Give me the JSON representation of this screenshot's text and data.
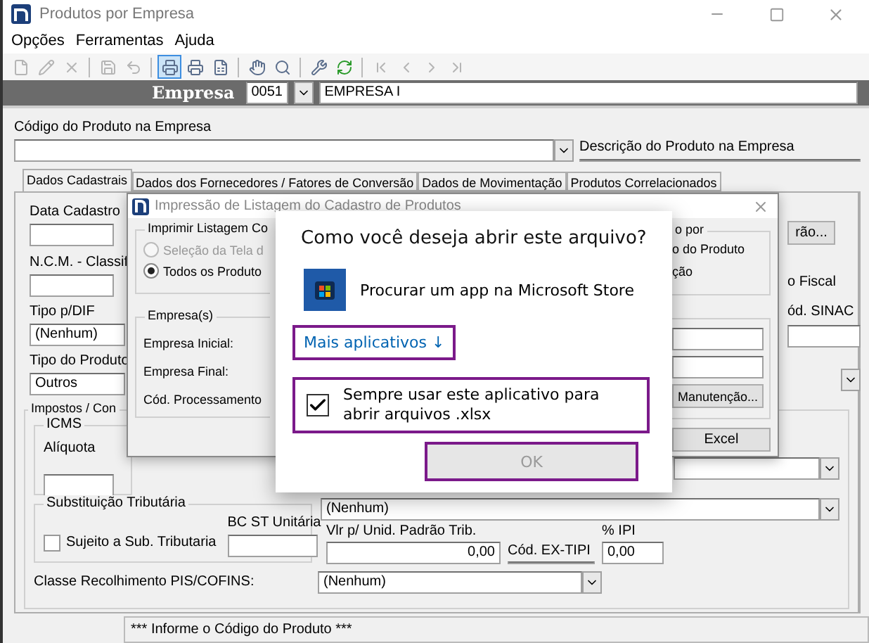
{
  "window": {
    "title": "Produtos por Empresa"
  },
  "menu": [
    "Opções",
    "Ferramentas",
    "Ajuda"
  ],
  "toolbar": [
    [
      {
        "disabled": true,
        "selected": false
      },
      {
        "disabled": true,
        "selected": false
      },
      {
        "disabled": true,
        "selected": false
      }
    ],
    [
      {
        "disabled": true,
        "selected": false
      },
      {
        "disabled": true,
        "selected": false
      }
    ],
    [
      {
        "disabled": false,
        "selected": true
      },
      {
        "disabled": false,
        "selected": false
      },
      {
        "disabled": false,
        "selected": false
      }
    ],
    [
      {
        "disabled": false,
        "selected": false
      },
      {
        "disabled": false,
        "selected": false
      }
    ],
    [
      {
        "disabled": false,
        "selected": false
      },
      {
        "disabled": false,
        "selected": false
      }
    ],
    [
      {
        "disabled": true,
        "selected": false
      },
      {
        "disabled": true,
        "selected": false
      },
      {
        "disabled": true,
        "selected": false
      },
      {
        "disabled": true,
        "selected": false
      }
    ]
  ],
  "empresa_bar": {
    "label": "Empresa",
    "code": "0051",
    "name": "EMPRESA I"
  },
  "product_code": {
    "label": "Código do Produto na Empresa"
  },
  "product_description": {
    "label": "Descrição do Produto na Empresa"
  },
  "tabs": [
    {
      "label": "Dados Cadastrais",
      "selected": true
    },
    {
      "label": "Dados dos Fornecedores / Fatores de Conversão",
      "selected": false
    },
    {
      "label": "Dados de Movimentação",
      "selected": false
    },
    {
      "label": "Produtos Correlacionados",
      "selected": false
    }
  ],
  "panel": {
    "data_cadastro": "Data Cadastro",
    "ncm": "N.C.M. - Classif",
    "tipo_dif": {
      "label": "Tipo p/DIF",
      "value": "(Nenhum)"
    },
    "tipo_produto": {
      "label": "Tipo do Produto",
      "value": "Outros"
    },
    "right_button": "rão...",
    "right_label_1": "o Fiscal",
    "right_label_2": "ód. SINAC",
    "impostos": {
      "title": "Impostos / Con",
      "icms": "ICMS",
      "aliquota": "Alíquota"
    },
    "substituicao": {
      "title": "Substituição Tributária",
      "checkbox_label": "Sujeito a Sub. Tributaria",
      "checked": false,
      "bc_label": "BC ST Unitária"
    },
    "ipi": {
      "select": "(Nenhum)",
      "fields": [
        {
          "label": "Vlr p/ Unid. Padrão Trib.",
          "value": "0,00"
        },
        {
          "label": "Cód. EX-TIPI"
        },
        {
          "label": "% IPI",
          "value": "0,00"
        }
      ]
    },
    "pis_cofins": {
      "label": "Classe Recolhimento PIS/COFINS:",
      "value": "(Nenhum)"
    }
  },
  "status_bar": "*** Informe o Código do Produto ***",
  "print_dialog": {
    "title": "Impressão de Listagem do Cadastro de Produtos",
    "group_1": "Imprimir Listagem Co",
    "radios": [
      {
        "label": "Seleção da Tela d",
        "selected": false,
        "disabled": true
      },
      {
        "label": "Todos os Produto",
        "selected": true,
        "disabled": false
      }
    ],
    "group_2": "Empresa(s)",
    "labels": [
      "Empresa Inicial:",
      "Empresa Final:",
      "Cód. Processamento"
    ],
    "right_group_legend": "o por",
    "right_options": [
      "o do Produto",
      "ção"
    ],
    "maintenance_button": "Manutenção...",
    "excel_button": "Excel"
  },
  "open_with_dialog": {
    "title": "Como você deseja abrir este arquivo?",
    "store_option": "Procurar um app na Microsoft Store",
    "more_apps": {
      "label": "Mais aplicativos ↓",
      "highlighted": true
    },
    "always_use": {
      "label": "Sempre usar este aplicativo para abrir arquivos .xlsx",
      "checked": true,
      "highlighted": true
    },
    "ok_button": {
      "label": "OK",
      "disabled": true,
      "highlighted": true
    }
  }
}
